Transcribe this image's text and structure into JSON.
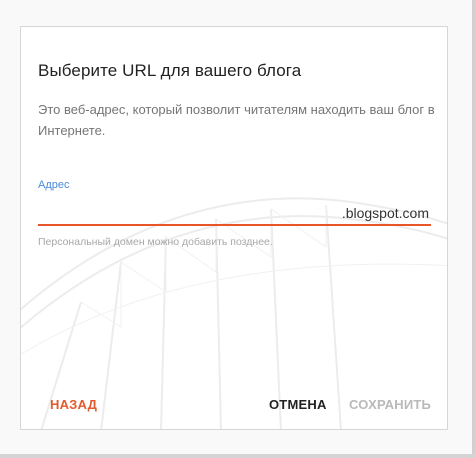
{
  "colors": {
    "accent": "#e8552b",
    "label_blue": "#4b8ad8",
    "disabled": "#b9b9b9"
  },
  "dialog": {
    "title": "Выберите URL для вашего блога",
    "description": "Это веб-адрес, который позволит читателям находить ваш блог в Интернете.",
    "address_field": {
      "label": "Адрес",
      "value": "",
      "placeholder": "",
      "domain_suffix": ".blogspot.com",
      "hint": "Персональный домен можно добавить позднее."
    },
    "buttons": {
      "back": "НАЗАД",
      "cancel": "ОТМЕНА",
      "save": "СОХРАНИТЬ"
    }
  }
}
